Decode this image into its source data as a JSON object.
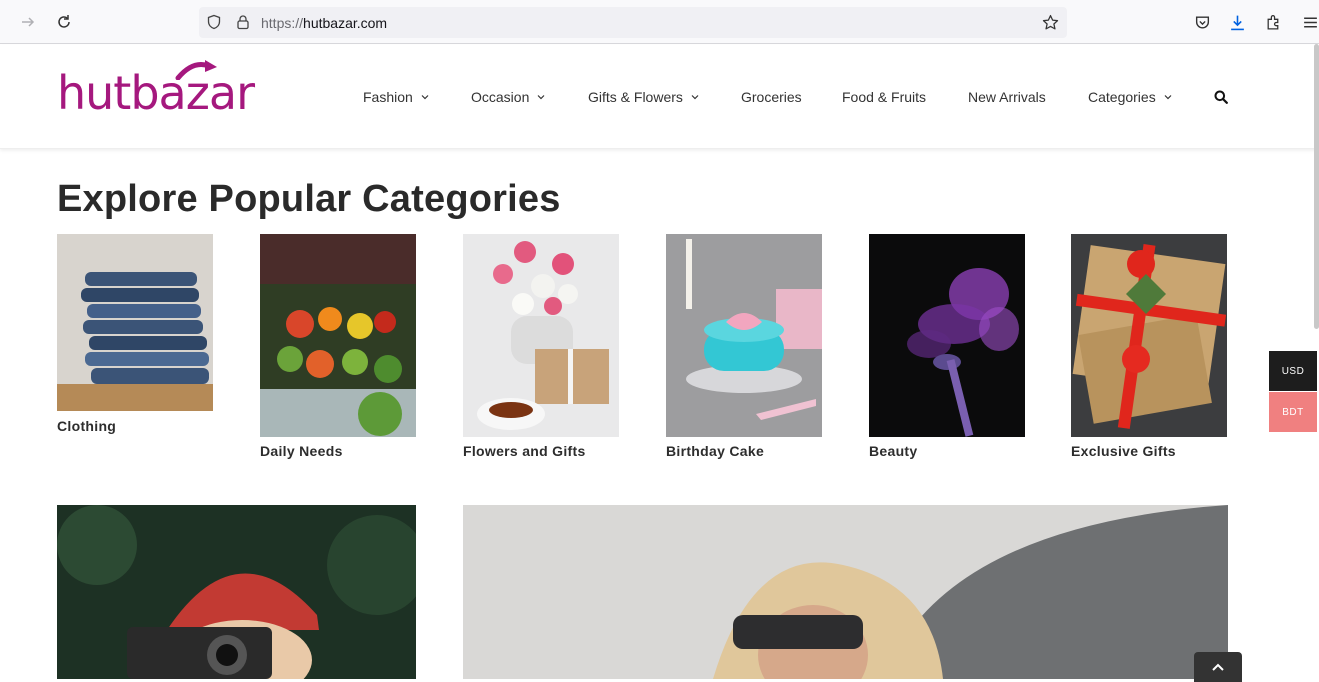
{
  "browser": {
    "url_protocol": "https://",
    "url_host": "hutbazar.com"
  },
  "site": {
    "logo_text": "hutbazar",
    "brand_color": "#a5187e",
    "nav": [
      {
        "label": "Fashion",
        "has_dropdown": true
      },
      {
        "label": "Occasion",
        "has_dropdown": true
      },
      {
        "label": "Gifts & Flowers",
        "has_dropdown": true
      },
      {
        "label": "Groceries",
        "has_dropdown": false
      },
      {
        "label": "Food & Fruits",
        "has_dropdown": false
      },
      {
        "label": "New Arrivals",
        "has_dropdown": false
      },
      {
        "label": "Categories",
        "has_dropdown": true
      }
    ]
  },
  "section": {
    "title": "Explore Popular Categories"
  },
  "categories": [
    {
      "label": "Clothing"
    },
    {
      "label": "Daily Needs"
    },
    {
      "label": "Flowers and Gifts"
    },
    {
      "label": "Birthday Cake"
    },
    {
      "label": "Beauty"
    },
    {
      "label": "Exclusive Gifts"
    }
  ],
  "currency": {
    "options": [
      "USD",
      "BDT"
    ],
    "selected": "USD",
    "usd_color": "#1d1d1d",
    "bdt_color": "#f08080"
  },
  "icons": [
    "forward-arrow-icon",
    "reload-icon",
    "shield-icon",
    "lock-icon",
    "star-icon",
    "pocket-icon",
    "download-icon",
    "extensions-icon",
    "menu-icon",
    "search-icon",
    "chevron-down-icon",
    "chevron-up-icon"
  ]
}
